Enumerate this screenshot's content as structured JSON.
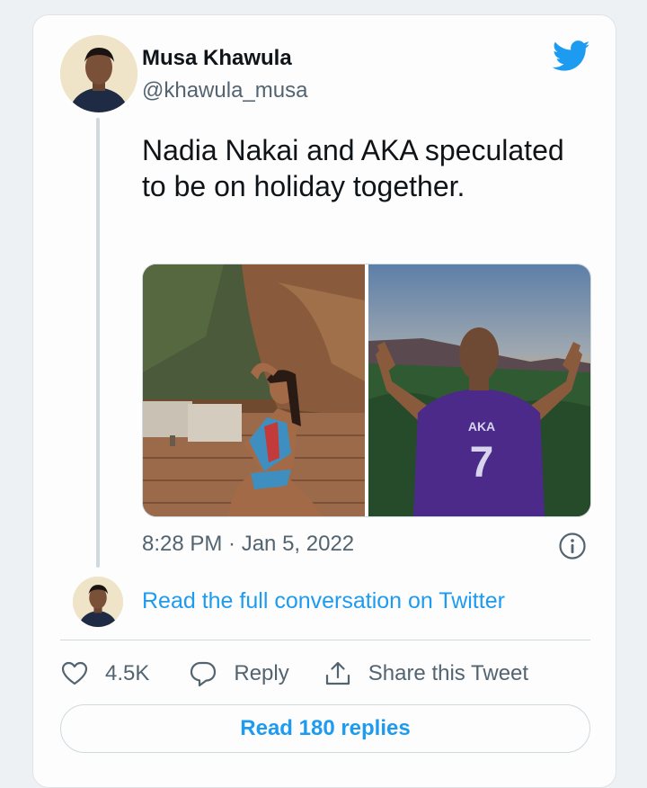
{
  "tweet": {
    "author_name": "Musa Khawula",
    "author_handle": "@khawula_musa",
    "text": "Nadia Nakai and AKA speculated to be on holiday together.",
    "timestamp": "8:28 PM · Jan 5, 2022",
    "media": [
      {
        "description": "woman in bikini posing on wooden deck"
      },
      {
        "description": "man in purple AKA 7 jersey facing sunset over mountains",
        "jersey_text": "AKA",
        "jersey_number": "7"
      }
    ]
  },
  "conversation": {
    "link_text": "Read the full conversation on Twitter"
  },
  "actions": {
    "likes": "4.5K",
    "reply_label": "Reply",
    "share_label": "Share this Tweet"
  },
  "replies_button": "Read 180 replies",
  "icons": {
    "brand": "twitter-bird-icon",
    "info": "info-icon",
    "like": "heart-icon",
    "reply": "reply-icon",
    "share": "share-icon"
  },
  "colors": {
    "accent": "#1d9bf0",
    "text": "#0f1419",
    "secondary": "#536471",
    "border": "#cfd9de",
    "jersey": "#4b2a8a"
  }
}
